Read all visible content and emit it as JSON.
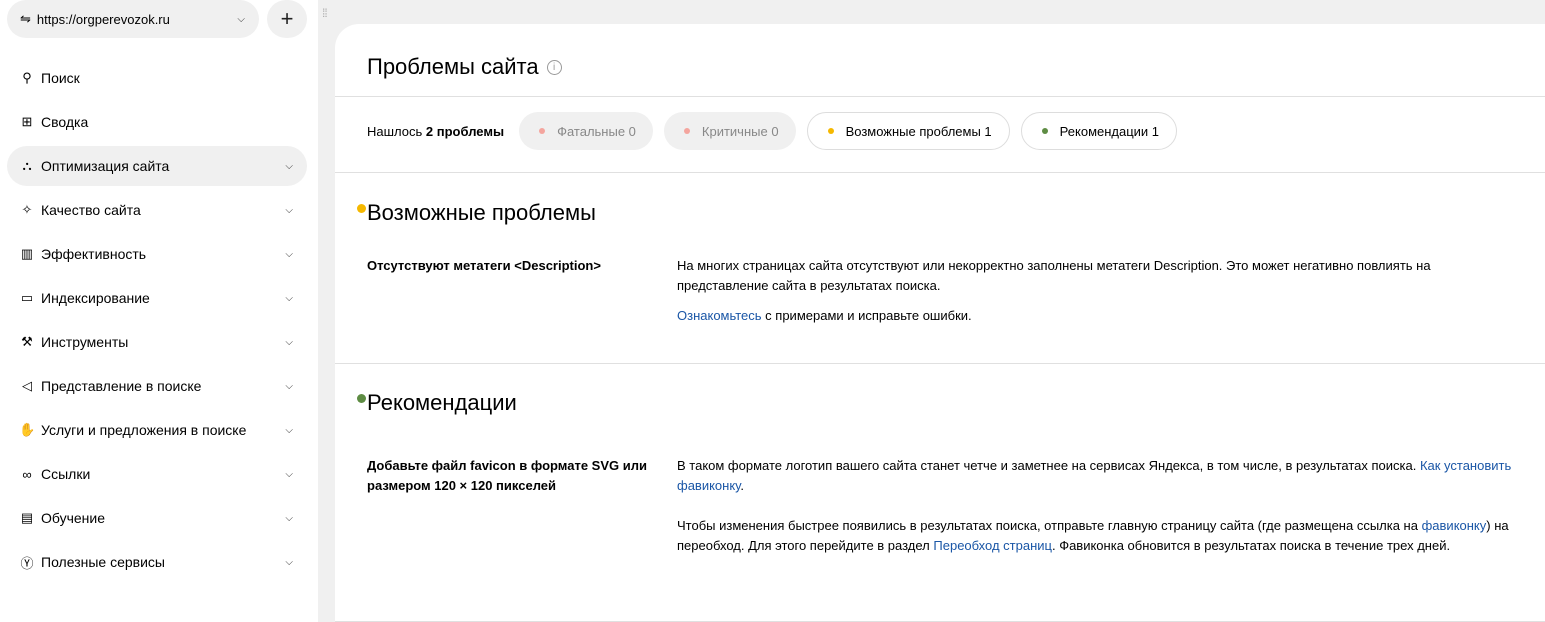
{
  "site": {
    "url": "https://orgperevozok.ru"
  },
  "nav": [
    {
      "label": "Поиск",
      "icon": "search-icon",
      "glyph": "⚲",
      "chev": false
    },
    {
      "label": "Сводка",
      "icon": "grid-icon",
      "glyph": "⊞",
      "chev": false
    },
    {
      "label": "Оптимизация сайта",
      "icon": "sitemap-icon",
      "glyph": "⛬",
      "chev": true,
      "active": true
    },
    {
      "label": "Качество сайта",
      "icon": "sparkle-icon",
      "glyph": "✧",
      "chev": true
    },
    {
      "label": "Эффективность",
      "icon": "bars-icon",
      "glyph": "▥",
      "chev": true
    },
    {
      "label": "Индексирование",
      "icon": "monitor-icon",
      "glyph": "▭",
      "chev": true
    },
    {
      "label": "Инструменты",
      "icon": "wrench-icon",
      "glyph": "⚒",
      "chev": true
    },
    {
      "label": "Представление в поиске",
      "icon": "megaphone-icon",
      "glyph": "◁",
      "chev": true
    },
    {
      "label": "Услуги и предложения в поиске",
      "icon": "hand-icon",
      "glyph": "✋",
      "chev": true
    },
    {
      "label": "Ссылки",
      "icon": "link-icon",
      "glyph": "∞",
      "chev": true
    },
    {
      "label": "Обучение",
      "icon": "book-icon",
      "glyph": "▤",
      "chev": true
    },
    {
      "label": "Полезные сервисы",
      "icon": "yandex-icon",
      "glyph": "Ⓨ",
      "chev": true
    }
  ],
  "page": {
    "title": "Проблемы сайта",
    "found_prefix": "Нашлось",
    "found_count": "2 проблемы"
  },
  "filters": [
    {
      "label": "Фатальные 0",
      "color": "#f4a59e",
      "style": "g"
    },
    {
      "label": "Критичные 0",
      "color": "#f4a59e",
      "style": "g"
    },
    {
      "label": "Возможные проблемы 1",
      "color": "#f5b800",
      "style": "w"
    },
    {
      "label": "Рекомендации 1",
      "color": "#5e8c43",
      "style": "w"
    }
  ],
  "possible": {
    "title": "Возможные проблемы",
    "color": "#f5b800",
    "item_title": "Отсутствуют метатеги <Description>",
    "text": "На многих страницах сайта отсутствуют или некорректно заполнены метатеги Description. Это может негативно повлиять на представление сайта в результатах поиска.",
    "link": "Ознакомьтесь",
    "link_tail": " с примерами и исправьте ошибки."
  },
  "recs": {
    "title": "Рекомендации",
    "color": "#5e8c43",
    "item_title": "Добавьте файл favicon в формате SVG или размером 120 × 120 пикселей",
    "p1": "В таком формате логотип вашего сайта станет четче и заметнее на сервисах Яндекса, в том числе, в результатах поиска. ",
    "p1_link": "Как установить фавиконку",
    "p1_end": ".",
    "p2a": "Чтобы изменения быстрее появились в результатах поиска, отправьте главную страницу сайта (где размещена ссылка на ",
    "p2_link1": "фавиконку",
    "p2b": ") на переобход. Для этого перейдите в раздел ",
    "p2_link2": "Переобход страниц",
    "p2c": ". Фавиконка обновится в результатах поиска в течение трех дней."
  }
}
